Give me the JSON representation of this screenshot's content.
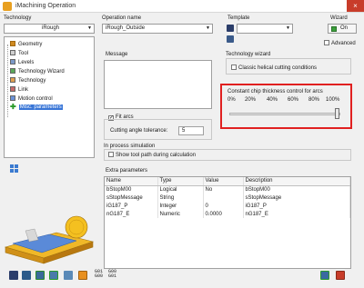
{
  "window": {
    "title": "iMachining Operation",
    "close_glyph": "×"
  },
  "technology": {
    "label": "Technology",
    "value": "iRough"
  },
  "operation": {
    "label": "Operation name",
    "value": "iRough_Outside"
  },
  "template": {
    "label": "Template"
  },
  "wizard": {
    "label": "Wizard",
    "on_label": "On",
    "advanced_label": "Advanced"
  },
  "tree": {
    "items": [
      {
        "label": "Geometry",
        "icon": "geometry-icon",
        "color": "#d08a20"
      },
      {
        "label": "Tool",
        "icon": "tool-icon",
        "color": "#888888"
      },
      {
        "label": "Levels",
        "icon": "levels-icon",
        "color": "#5577aa"
      },
      {
        "label": "Technology Wizard",
        "icon": "wizard-icon",
        "color": "#3a8a3a"
      },
      {
        "label": "Technology",
        "icon": "technology-icon",
        "color": "#cc8833"
      },
      {
        "label": "Link",
        "icon": "link-icon",
        "color": "#aa4444"
      },
      {
        "label": "Motion control",
        "icon": "motion-icon",
        "color": "#4477cc"
      },
      {
        "label": "Misc. parameters",
        "icon": "plus-icon",
        "color": "#2a9a2a"
      }
    ]
  },
  "message": {
    "label": "Message"
  },
  "fit_arcs": {
    "label": "Fit arcs",
    "checked": true
  },
  "cutting_tol": {
    "label": "Cutting angle tolerance:",
    "value": "5"
  },
  "in_process": {
    "title": "In process simulation",
    "show_path_label": "Show tool path during calculation"
  },
  "tech_wizard": {
    "title": "Technology wizard",
    "classic_label": "Classic helical cutting conditions"
  },
  "chip": {
    "title": "Constant chip thickness control for arcs",
    "ticks": [
      "0%",
      "20%",
      "40%",
      "60%",
      "80%",
      "100%"
    ],
    "value_percent": 100
  },
  "extra": {
    "title": "Extra parameters",
    "columns": [
      "Name",
      "Type",
      "Value",
      "Description"
    ],
    "rows": [
      [
        "bStopM00",
        "Logical",
        "No",
        "bStopM00"
      ],
      [
        "sStopMessage",
        "String",
        "",
        "sStopMessage"
      ],
      [
        "iG187_P",
        "Integer",
        "0",
        "iG187_P"
      ],
      [
        "nG187_E",
        "Numeric",
        "0.0000",
        "nG187_E"
      ]
    ]
  },
  "gcode": {
    "line1": "G01",
    "line2": "G00",
    "line3": "G00",
    "line4": "G01"
  },
  "colors": {
    "highlight": "#e02020",
    "selection": "#3875d7",
    "wizard_on": "#3ca03c"
  }
}
